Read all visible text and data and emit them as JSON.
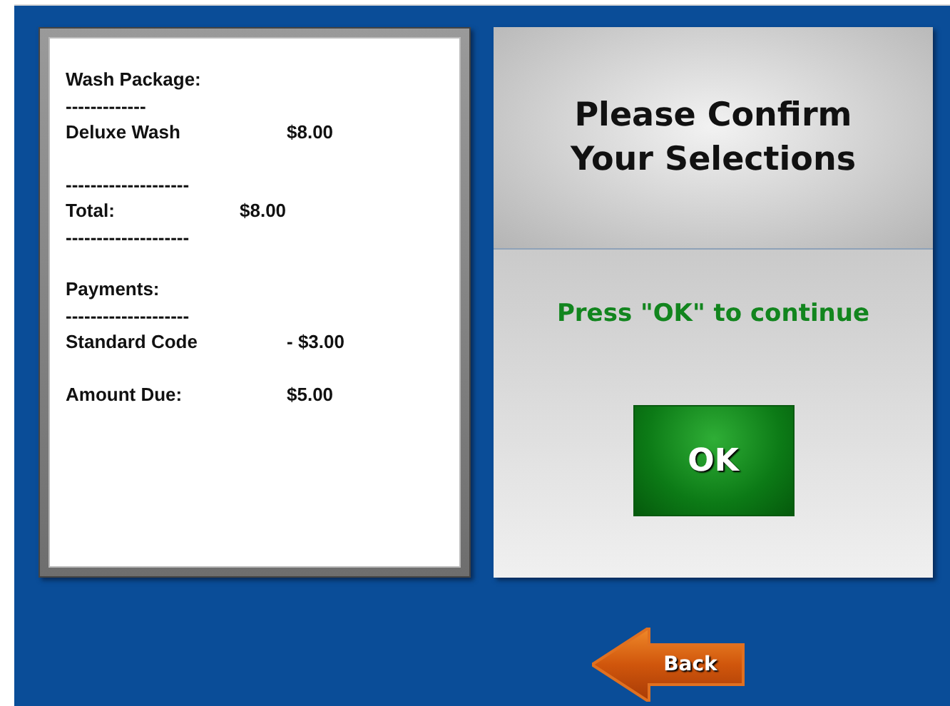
{
  "receipt": {
    "sections": [
      {
        "lines": [
          {
            "kind": "heading",
            "text": "Wash Package:"
          },
          {
            "kind": "rule",
            "text": "-------------"
          },
          {
            "kind": "item",
            "label": "Deluxe Wash",
            "amount": "$8.00"
          }
        ]
      },
      {
        "lines": [
          {
            "kind": "rule",
            "text": "--------------------"
          },
          {
            "kind": "total",
            "label": "Total:",
            "amount": "$8.00"
          },
          {
            "kind": "rule",
            "text": "--------------------"
          }
        ]
      },
      {
        "lines": [
          {
            "kind": "heading",
            "text": "Payments:"
          },
          {
            "kind": "rule",
            "text": "--------------------"
          },
          {
            "kind": "item",
            "label": "Standard Code",
            "amount": "- $3.00"
          }
        ]
      },
      {
        "lines": [
          {
            "kind": "item",
            "label": "Amount Due:",
            "amount": "$5.00"
          }
        ]
      }
    ]
  },
  "confirm": {
    "title": "Please Confirm Your Selections",
    "instruction": "Press \"OK\" to continue",
    "ok_button": "OK"
  },
  "back_button": "Back"
}
